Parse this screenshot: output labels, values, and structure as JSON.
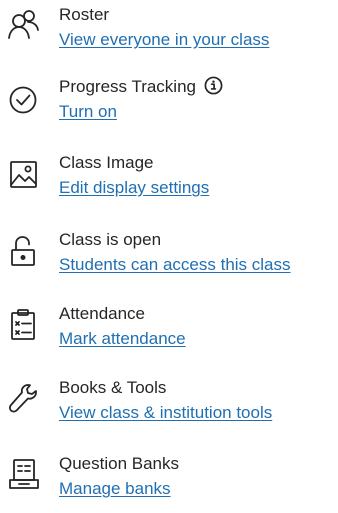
{
  "items": [
    {
      "icon": "roster-icon",
      "title": "Roster",
      "link": "View everyone in your class"
    },
    {
      "icon": "progress-check-icon",
      "title": "Progress Tracking",
      "link": "Turn on",
      "has_info_icon": true,
      "info_icon": "info-icon"
    },
    {
      "icon": "image-icon",
      "title": "Class Image",
      "link": "Edit display settings"
    },
    {
      "icon": "unlock-icon",
      "title": "Class is open",
      "link": "Students can access this class"
    },
    {
      "icon": "attendance-clipboard-icon",
      "title": "Attendance",
      "link": "Mark attendance"
    },
    {
      "icon": "wrench-icon",
      "title": "Books & Tools",
      "link": "View class & institution tools"
    },
    {
      "icon": "question-bank-icon",
      "title": "Question Banks",
      "link": "Manage banks"
    }
  ],
  "colors": {
    "text": "#262626",
    "link": "#1f6fb2"
  }
}
